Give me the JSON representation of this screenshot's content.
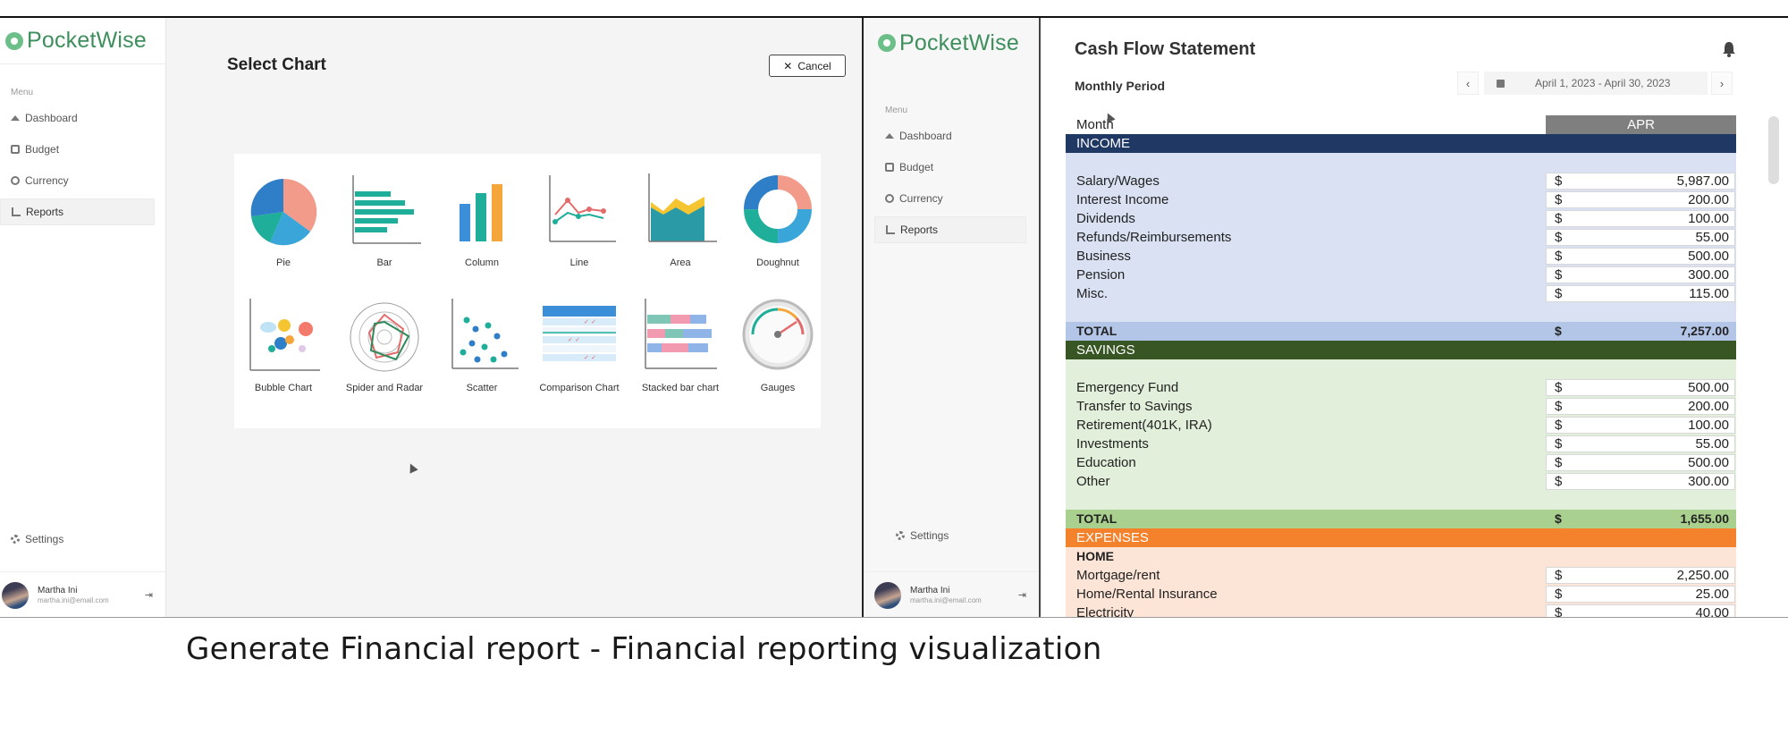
{
  "caption": "Generate Financial report - Financial reporting visualization",
  "app": {
    "name": "PocketWise",
    "menu_caption": "Menu",
    "nav": [
      "Dashboard",
      "Budget",
      "Currency",
      "Reports"
    ],
    "settings": "Settings",
    "user": {
      "name": "Martha Ini",
      "email": "martha.ini@email.com"
    },
    "colors": {
      "brand": "#3f8f5e",
      "income_header": "#1f3864",
      "savings_header": "#375623",
      "expenses_header": "#f4822d"
    }
  },
  "select_chart": {
    "title": "Select  Chart",
    "cancel": "Cancel",
    "charts": [
      "Pie",
      "Bar",
      "Column",
      "Line",
      "Area",
      "Doughnut",
      "Bubble Chart",
      "Spider and Radar",
      "Scatter",
      "Comparison Chart",
      "Stacked bar chart",
      "Gauges"
    ]
  },
  "cash_flow": {
    "title": "Cash Flow Statement",
    "period_label": "Monthly Period",
    "date_range": "April 1, 2023 - April 30, 2023",
    "month_label": "Month",
    "month": "APR",
    "income": {
      "header": "INCOME",
      "items": [
        {
          "label": "Salary/Wages",
          "currency": "$",
          "amount": "5,987.00"
        },
        {
          "label": "Interest Income",
          "currency": "$",
          "amount": "200.00"
        },
        {
          "label": "Dividends",
          "currency": "$",
          "amount": "100.00"
        },
        {
          "label": "Refunds/Reimbursements",
          "currency": "$",
          "amount": "55.00"
        },
        {
          "label": "Business",
          "currency": "$",
          "amount": "500.00"
        },
        {
          "label": "Pension",
          "currency": "$",
          "amount": "300.00"
        },
        {
          "label": "Misc.",
          "currency": "$",
          "amount": "115.00"
        }
      ],
      "total_label": "TOTAL",
      "total_currency": "$",
      "total": "7,257.00"
    },
    "savings": {
      "header": "SAVINGS",
      "items": [
        {
          "label": "Emergency Fund",
          "currency": "$",
          "amount": "500.00"
        },
        {
          "label": "Transfer to Savings",
          "currency": "$",
          "amount": "200.00"
        },
        {
          "label": "Retirement(401K, IRA)",
          "currency": "$",
          "amount": "100.00"
        },
        {
          "label": "Investments",
          "currency": "$",
          "amount": "55.00"
        },
        {
          "label": "Education",
          "currency": "$",
          "amount": "500.00"
        },
        {
          "label": "Other",
          "currency": "$",
          "amount": "300.00"
        }
      ],
      "total_label": "TOTAL",
      "total_currency": "$",
      "total": "1,655.00"
    },
    "expenses": {
      "header": "EXPENSES",
      "subheader": "HOME",
      "items": [
        {
          "label": "Mortgage/rent",
          "currency": "$",
          "amount": "2,250.00"
        },
        {
          "label": "Home/Rental Insurance",
          "currency": "$",
          "amount": "25.00"
        },
        {
          "label": "Electricity",
          "currency": "$",
          "amount": "40.00"
        }
      ]
    }
  }
}
